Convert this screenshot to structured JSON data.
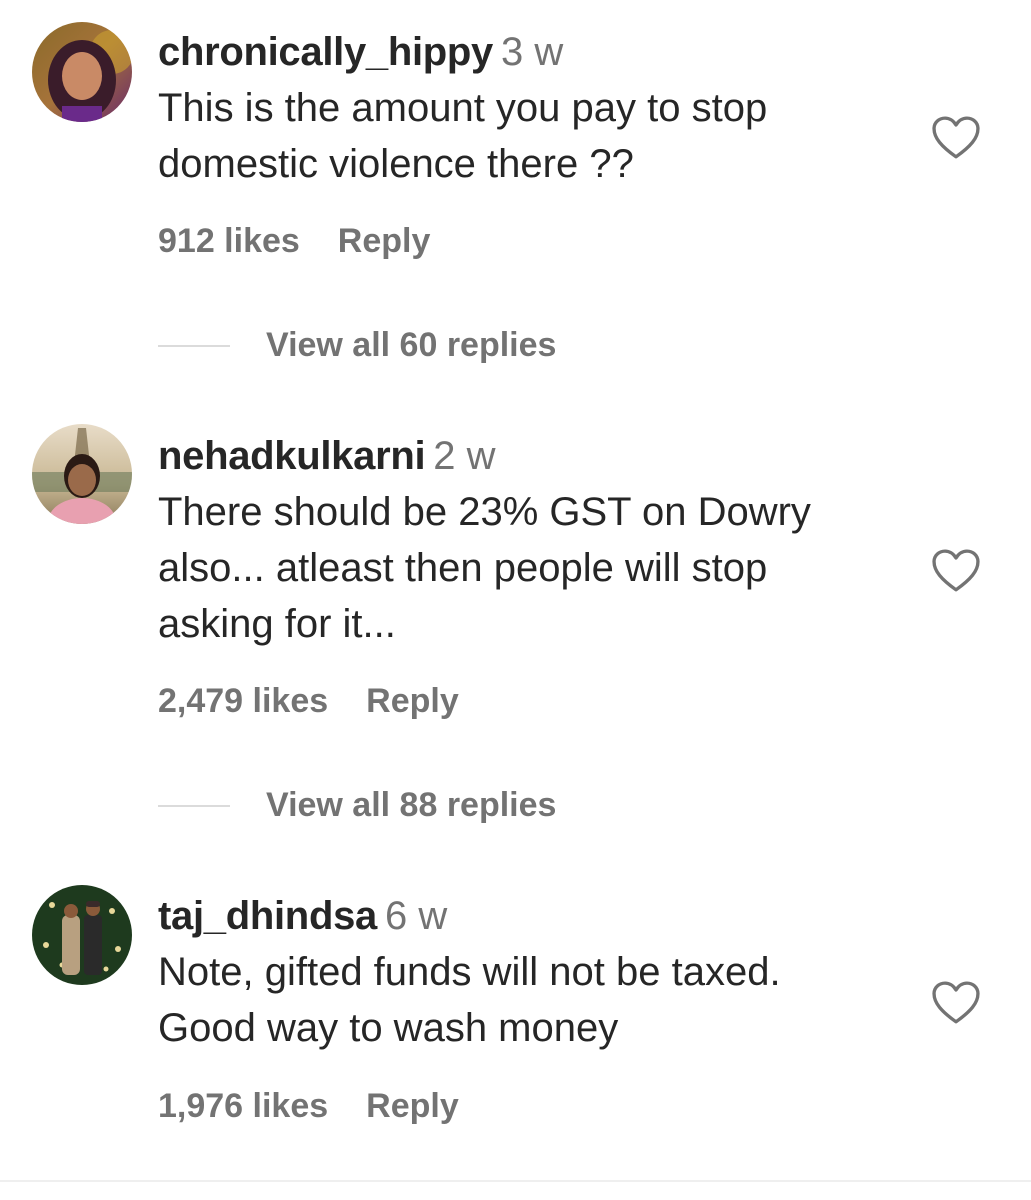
{
  "comments": [
    {
      "username": "chronically_hippy",
      "time": "3 w",
      "text": "This is the amount you pay to stop\ndomestic violence there ??",
      "likes": "912 likes",
      "reply": "Reply",
      "view_all": "View all 60 replies"
    },
    {
      "username": "nehadkulkarni",
      "time": "2 w",
      "text": "There should be 23% GST on Dowry\nalso... atleast then people will stop\nasking for it...",
      "likes": "2,479 likes",
      "reply": "Reply",
      "view_all": "View all 88 replies"
    },
    {
      "username": "taj_dhindsa",
      "time": "6 w",
      "text": "Note, gifted funds will not be taxed.\nGood way to wash money",
      "likes": "1,976 likes",
      "reply": "Reply"
    }
  ],
  "icons": {
    "like": "heart-outline-icon",
    "avatar": "user-avatar"
  },
  "colors": {
    "text": "#262626",
    "secondary": "#737373",
    "divider": "#dbdbdb"
  }
}
